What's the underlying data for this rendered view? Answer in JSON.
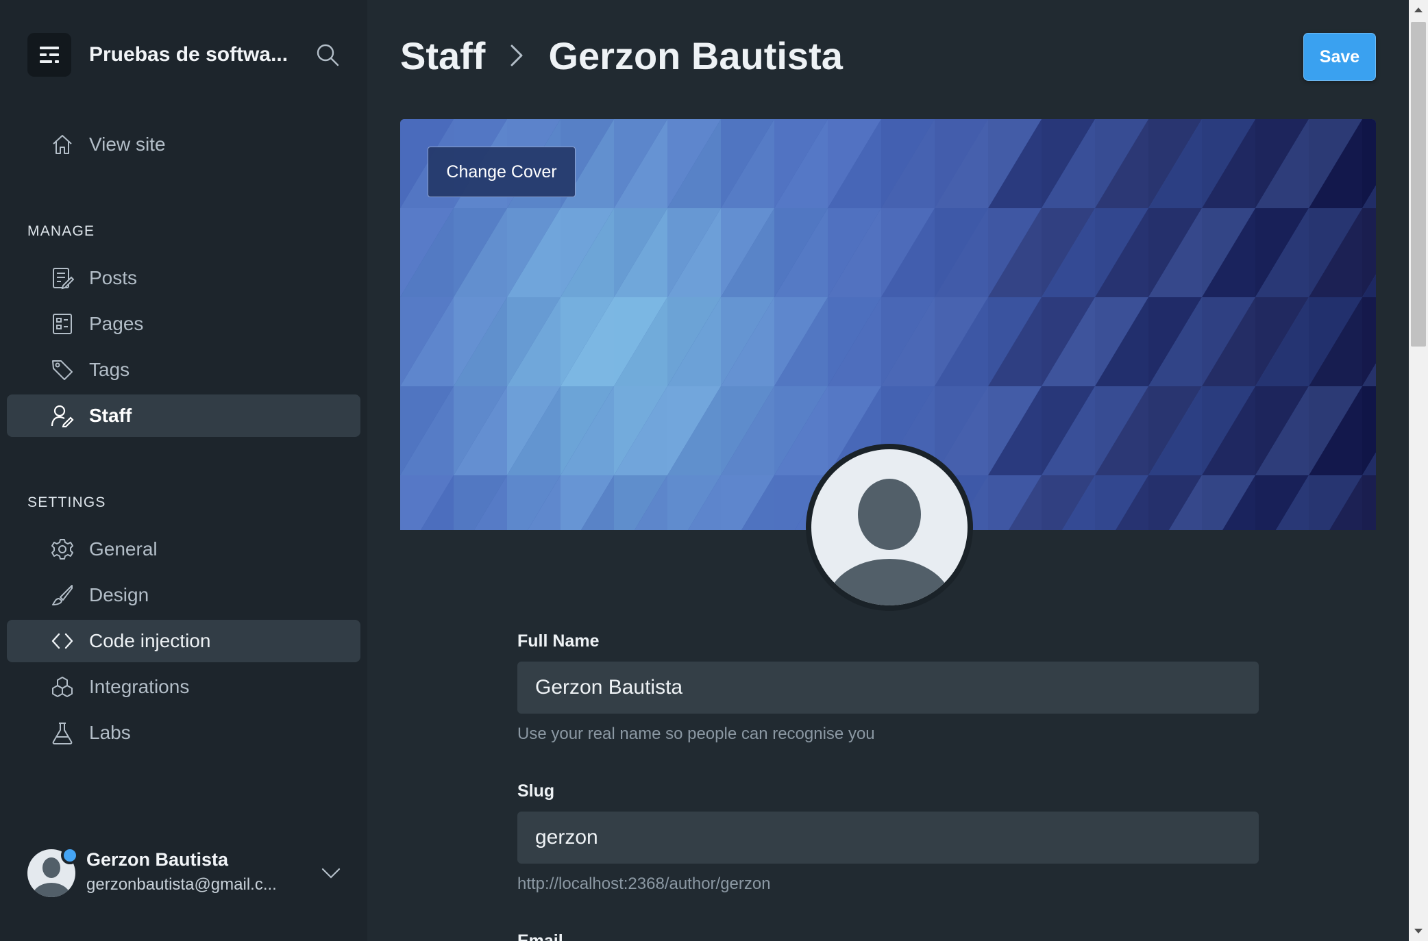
{
  "sidebar": {
    "site_title": "Pruebas de softwa...",
    "view_site": "View site",
    "manage_label": "MANAGE",
    "manage_items": [
      {
        "label": "Posts",
        "icon": "posts-icon"
      },
      {
        "label": "Pages",
        "icon": "pages-icon"
      },
      {
        "label": "Tags",
        "icon": "tag-icon"
      },
      {
        "label": "Staff",
        "icon": "staff-icon"
      }
    ],
    "settings_label": "SETTINGS",
    "settings_items": [
      {
        "label": "General",
        "icon": "gear-icon"
      },
      {
        "label": "Design",
        "icon": "brush-icon"
      },
      {
        "label": "Code injection",
        "icon": "code-icon"
      },
      {
        "label": "Integrations",
        "icon": "integrations-icon"
      },
      {
        "label": "Labs",
        "icon": "flask-icon"
      }
    ],
    "active_item": "Staff",
    "user": {
      "name": "Gerzon Bautista",
      "email": "gerzonbautista@gmail.c..."
    }
  },
  "header": {
    "breadcrumb_parent": "Staff",
    "breadcrumb_current": "Gerzon Bautista",
    "save_label": "Save"
  },
  "cover": {
    "change_cover_label": "Change Cover"
  },
  "form": {
    "full_name": {
      "label": "Full Name",
      "value": "Gerzon Bautista",
      "hint": "Use your real name so people can recognise you"
    },
    "slug": {
      "label": "Slug",
      "value": "gerzon",
      "hint": "http://localhost:2368/author/gerzon"
    },
    "email": {
      "label": "Email"
    }
  },
  "colors": {
    "sidebar_bg": "#1d252c",
    "main_bg": "#212a31",
    "accent": "#3aa1f0",
    "active_bg": "#323d46",
    "input_bg": "#343f47"
  }
}
